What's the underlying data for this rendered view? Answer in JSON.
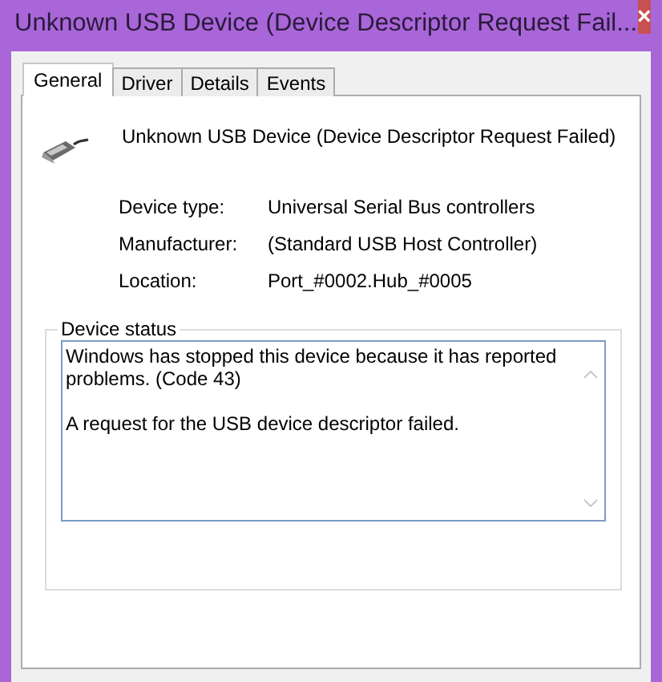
{
  "window": {
    "title": "Unknown USB Device (Device Descriptor Request Fail...",
    "close": "×"
  },
  "tabs": [
    {
      "label": "General",
      "selected": true
    },
    {
      "label": "Driver",
      "selected": false
    },
    {
      "label": "Details",
      "selected": false
    },
    {
      "label": "Events",
      "selected": false
    }
  ],
  "device": {
    "name": "Unknown USB Device (Device Descriptor Request Failed)"
  },
  "properties": [
    {
      "label": "Device type:",
      "value": "Universal Serial Bus controllers"
    },
    {
      "label": "Manufacturer:",
      "value": "(Standard USB Host Controller)"
    },
    {
      "label": "Location:",
      "value": "Port_#0002.Hub_#0005"
    }
  ],
  "device_status": {
    "title": "Device status",
    "paragraphs": [
      "Windows has stopped this device because it has reported problems. (Code 43)",
      "A request for the USB device descriptor failed."
    ]
  }
}
